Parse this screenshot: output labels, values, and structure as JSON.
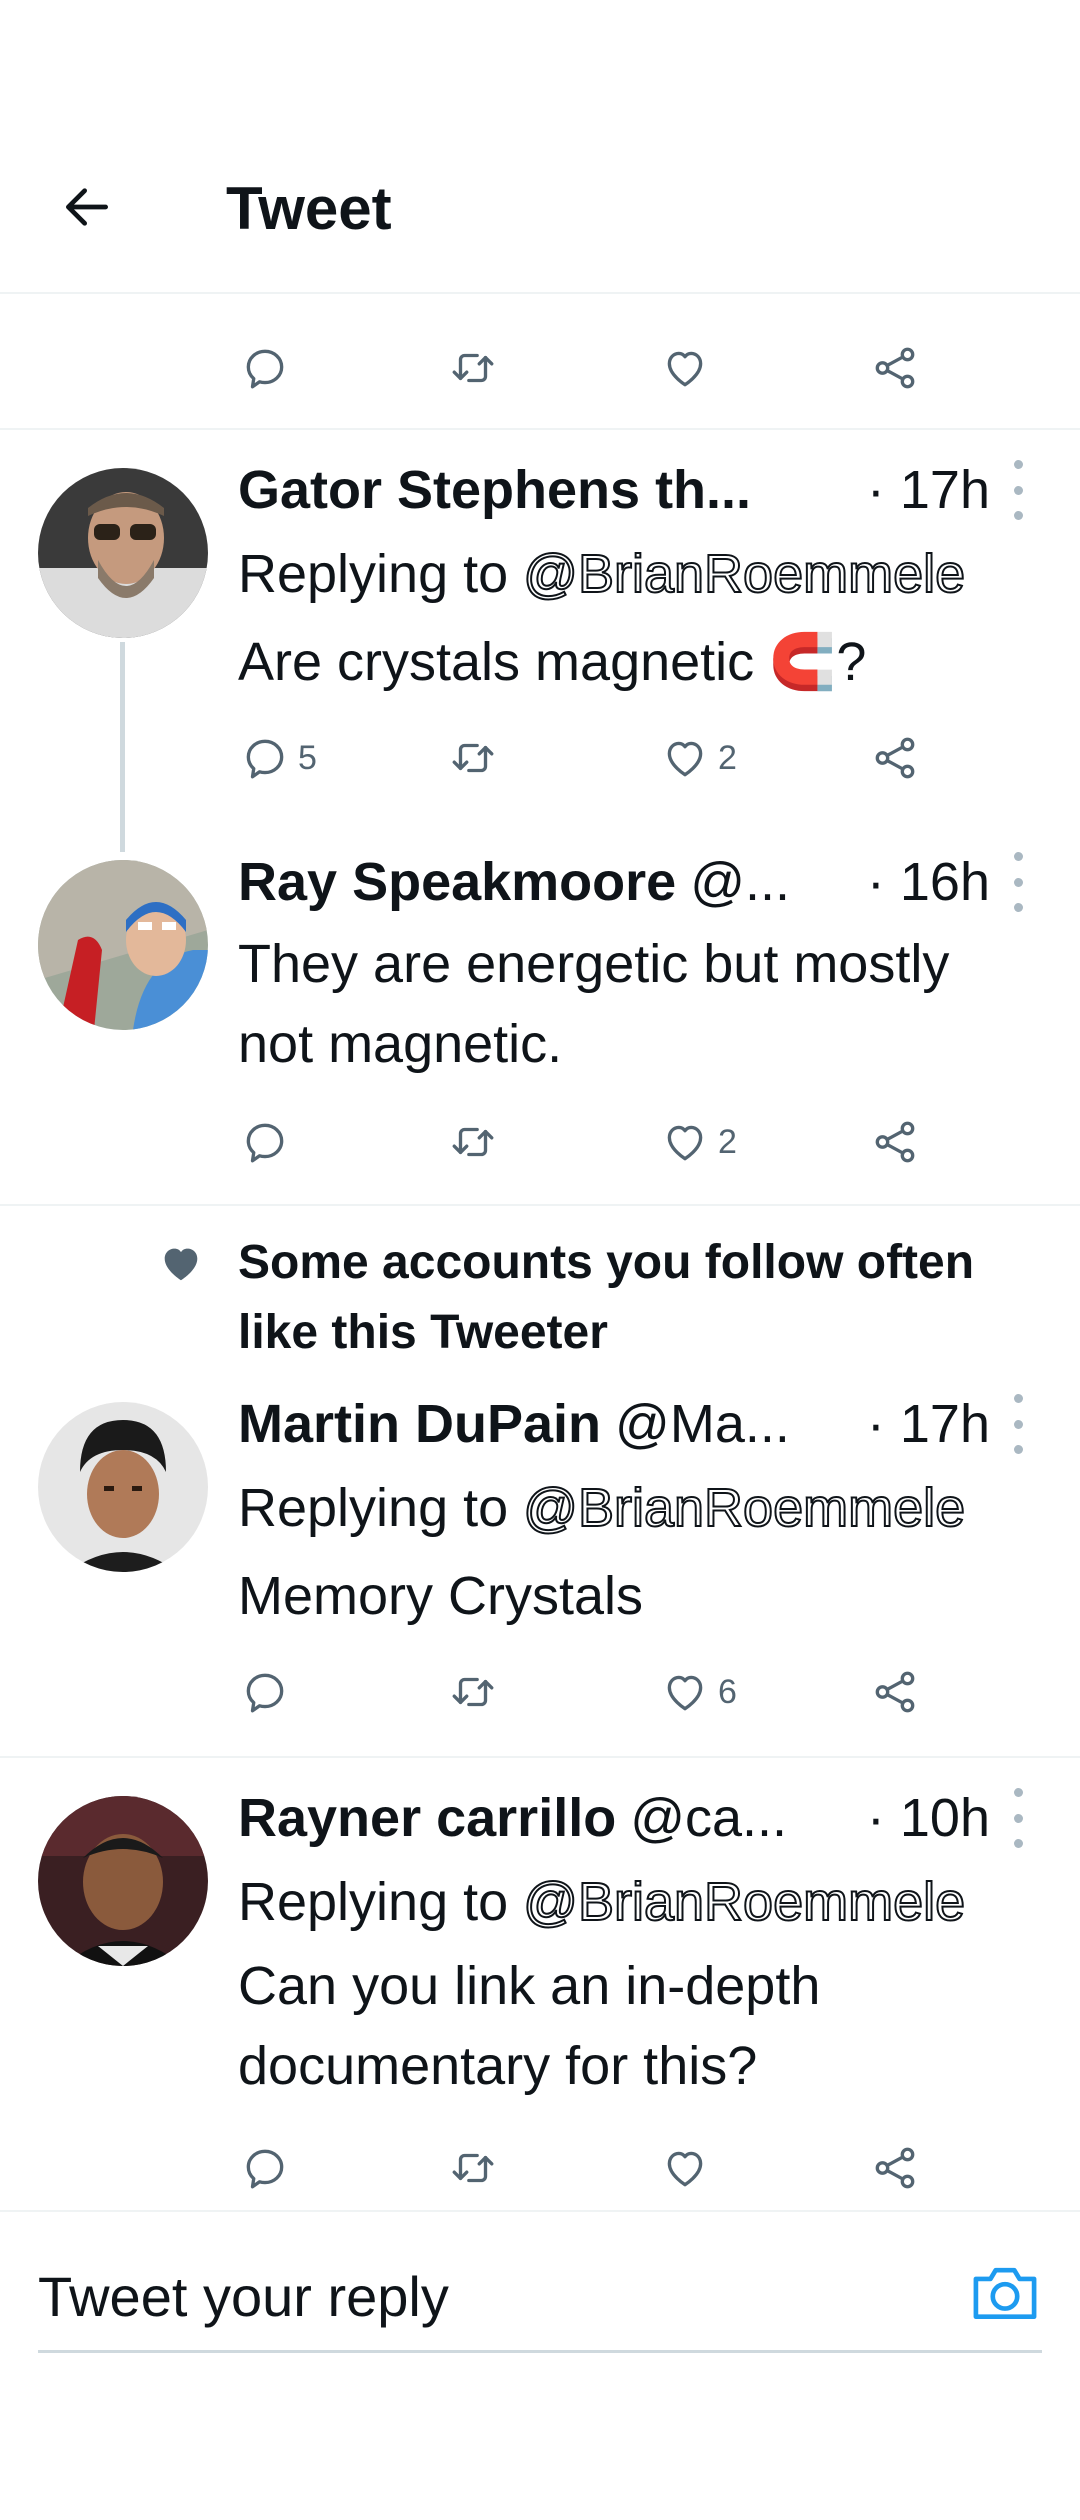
{
  "header": {
    "title": "Tweet"
  },
  "tweets": [
    {
      "name": "Gator Stephens th...",
      "handle": "",
      "time": "· 17h",
      "replying_prefix": "Replying to ",
      "replying_to": "@BrianRoemmele",
      "text": "Are crystals magnetic 🧲?",
      "replies": "5",
      "retweets": "",
      "likes": "2"
    },
    {
      "name": "Ray Speakmoore",
      "handle": "@...",
      "time": "· 16h",
      "text": "They are energetic but mostly not magnetic.",
      "replies": "",
      "retweets": "",
      "likes": "2"
    },
    {
      "social_context": "Some accounts you follow often like this Tweeter",
      "name": "Martin DuPain",
      "handle": "@Ma...",
      "time": "· 17h",
      "replying_prefix": "Replying to ",
      "replying_to": "@BrianRoemmele",
      "text": "Memory Crystals",
      "replies": "",
      "retweets": "",
      "likes": "6"
    },
    {
      "name": "Rayner carrillo",
      "handle": "@ca...",
      "time": "· 10h",
      "replying_prefix": "Replying to ",
      "replying_to": "@BrianRoemmele",
      "text": "Can you link an in-depth documentary for this?",
      "replies": "",
      "retweets": "",
      "likes": ""
    }
  ],
  "composer": {
    "placeholder": "Tweet your reply"
  },
  "icons": {
    "back": "arrow-left-icon",
    "reply": "reply-icon",
    "retweet": "retweet-icon",
    "like": "heart-icon",
    "share": "share-icon",
    "more": "more-vertical-icon",
    "camera": "camera-icon"
  },
  "colors": {
    "accent": "#1d9bf0",
    "icon_gray": "#536471",
    "line": "#cfd9de"
  }
}
